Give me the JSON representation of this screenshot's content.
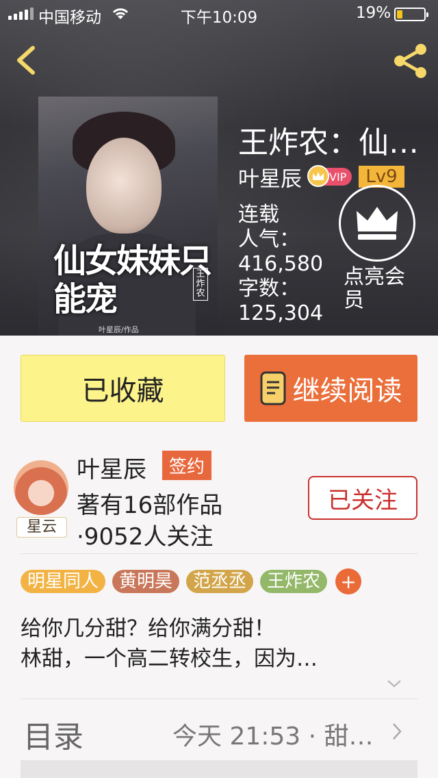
{
  "status_bar": {
    "carrier": "中国移动",
    "time": "下午10:09",
    "battery_pct": "19%"
  },
  "nav": {
    "back_icon": "chevron-left-icon",
    "share_icon": "share-icon"
  },
  "book": {
    "title": "王炸农：仙…",
    "cover_title": "仙女妹妹只能宠",
    "cover_tag": "王炸农",
    "cover_byline": "叶星辰/作品",
    "author": "叶星辰",
    "vip_label": "VIP",
    "level": "Lv9",
    "status": "连载",
    "popularity_label": "人气：",
    "popularity_value": "416,580",
    "words_label": "字数：",
    "words_value": "125,304"
  },
  "member": {
    "icon": "crown-icon",
    "label": "点亮会员"
  },
  "actions": {
    "favorited_label": "已收藏",
    "continue_label": "继续阅读"
  },
  "author_card": {
    "avatar_tag": "星云",
    "name": "叶星辰",
    "signed_label": "签约",
    "works": "著有16部作品",
    "fans": "·9052人关注",
    "follow_label": "已关注"
  },
  "tags": [
    {
      "label": "明星同人",
      "color": "#f2b344"
    },
    {
      "label": "黄明昊",
      "color": "#c9775a"
    },
    {
      "label": "范丞丞",
      "color": "#d2a54a"
    },
    {
      "label": "王炸农",
      "color": "#94b86a"
    }
  ],
  "tag_add_label": "+",
  "description": {
    "line1": "给你几分甜？给你满分甜！",
    "line2": "林甜，一个高二转校生，因为…"
  },
  "toc": {
    "label": "目录",
    "update": "今天 21:53 · 甜…"
  }
}
